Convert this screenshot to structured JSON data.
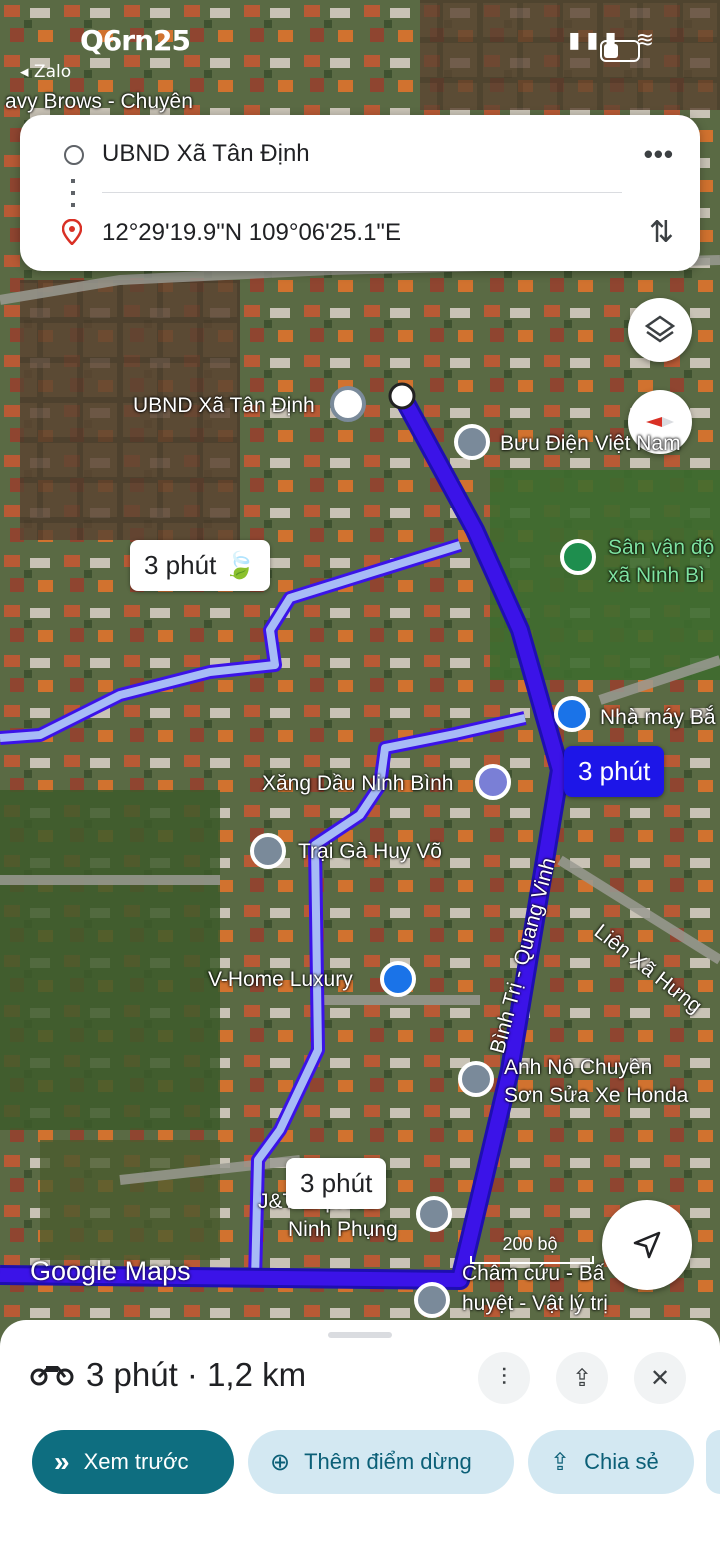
{
  "status_bar": {
    "time": "Q6rn25",
    "back_app": "◂ Zalo"
  },
  "directions": {
    "origin": "UBND Xã Tân Định",
    "destination": "12°29'19.9\"N 109°06'25.1\"E"
  },
  "map": {
    "labels": {
      "partial_top": "avy Brows - Chuyên",
      "ubnd": "UBND Xã Tân Định",
      "buu_dien": "Bưu Điện Việt Nam",
      "san_van_dong_1": "Sân vận độ",
      "san_van_dong_2": "xã Ninh Bì",
      "nha_may": "Nhà máy Bắ",
      "xang_dau": "Xăng Dầu Ninh Bình",
      "trai_ga": "Trại Gà Huy Võ",
      "lien_xa": "Liên Xã Hưng",
      "vhome": "V-Home Luxury",
      "road": "Bình Trị - Quang Vinh",
      "anh_no_1": "Anh Nô Chuyên",
      "anh_no_2": "Sơn Sửa Xe Honda",
      "jt_1": "J&T Express",
      "jt_2": "Ninh Phụng",
      "cham_cuu_1": "Châm cứu - Bấ",
      "cham_cuu_2": "huyệt - Vật lý trị"
    },
    "route_bubbles": {
      "alt1": "3 phút",
      "selected": "3 phút",
      "alt2": "3 phút"
    },
    "scale": "200 bộ",
    "watermark": "Google Maps",
    "colors": {
      "route_main": "#3b13e8",
      "route_alt": "#9fb3f5"
    }
  },
  "sheet": {
    "summary": "3 phút · 1,2 km",
    "chips": {
      "preview": "Xem trước",
      "add_stop": "Thêm điểm dừng",
      "share": "Chia sẻ"
    }
  }
}
